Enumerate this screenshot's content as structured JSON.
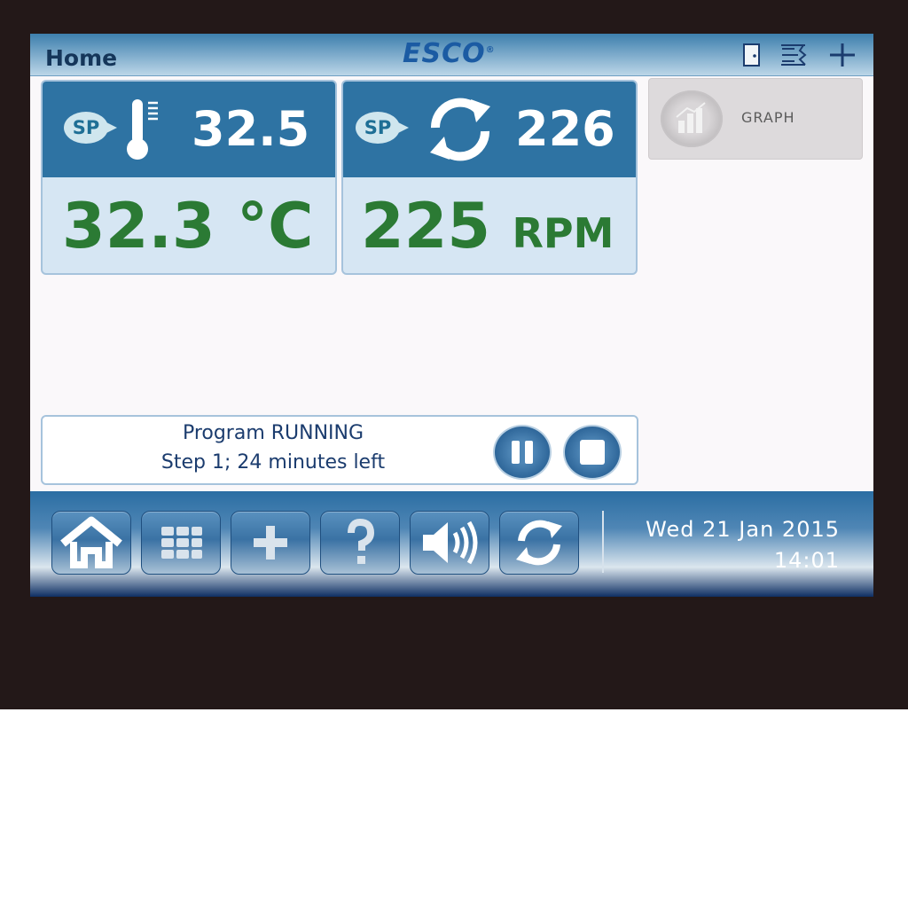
{
  "header": {
    "title": "Home",
    "brand": "ESCO"
  },
  "temperature": {
    "sp_label": "SP",
    "setpoint": "32.5",
    "actual": "32.3",
    "unit": "°C"
  },
  "speed": {
    "sp_label": "SP",
    "setpoint": "226",
    "actual": "225",
    "unit": "RPM"
  },
  "graph": {
    "label": "GRAPH"
  },
  "program": {
    "status": "Program RUNNING",
    "step": "Step 1; 24 minutes left"
  },
  "footer": {
    "date": "Wed 21 Jan 2015",
    "time": "14:01"
  },
  "colors": {
    "accent": "#2e73a3",
    "value_green": "#2b7a34",
    "text_navy": "#1b3c6e"
  },
  "icons": [
    "door-icon",
    "temperature-chart-icon",
    "plus-icon",
    "thermometer-icon",
    "rotation-icon",
    "graph-icon",
    "pause-icon",
    "stop-icon",
    "home-icon",
    "grid-menu-icon",
    "add-icon",
    "help-icon",
    "speaker-icon",
    "refresh-icon"
  ]
}
